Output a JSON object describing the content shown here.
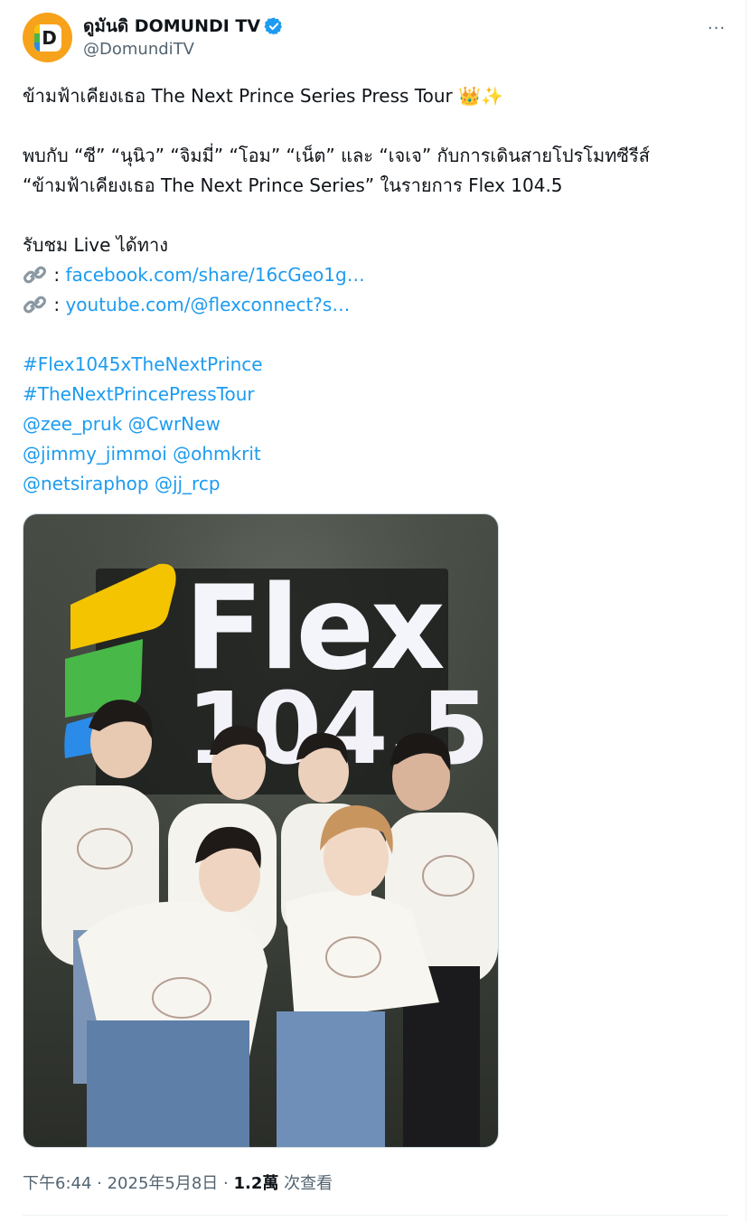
{
  "author": {
    "display_name": "ดูมันดิ DOMUNDI TV",
    "handle": "@DomundiTV",
    "avatar_letter": "D",
    "verified_color": "#1d9bf0",
    "avatar_color": "#f7a21b"
  },
  "menu": {
    "more_glyph": "···"
  },
  "post": {
    "line1": "ข้ามฟ้าเคียงเธอ The Next Prince Series Press Tour 👑✨",
    "line2": "พบกับ “ซี” “นุนิว” “จิมมี่” “โอม” “เน็ต” และ “เจเจ” กับการเดินสายโปรโมทซีรีส์",
    "line3": "“ข้ามฟ้าเคียงเธอ The Next Prince Series” ในรายการ Flex 104.5",
    "line4": "รับชม Live ได้ทาง",
    "link1_sep": " : ",
    "link1": "facebook.com/share/16cGeo1g…",
    "link2_sep": " : ",
    "link2": "youtube.com/@flexconnect?s…",
    "hashtag1": "#Flex1045xTheNextPrince",
    "hashtag2": "#TheNextPrincePressTour",
    "mentions1": "@zee_pruk @CwrNew",
    "mentions2": "@jimmy_jimmoi @ohmkrit",
    "mentions3": "@netsiraphop @jj_rcp"
  },
  "media": {
    "sign_word": "Flex",
    "sign_freq": "104.5",
    "logo_colors": [
      "#f4c400",
      "#48b848",
      "#2a8ce8"
    ],
    "wall_color": "#3a3f38"
  },
  "meta": {
    "time": "下午6:44",
    "sep1": " · ",
    "date": "2025年5月8日",
    "sep2": " · ",
    "views": "1.2萬",
    "views_label": " 次查看"
  }
}
